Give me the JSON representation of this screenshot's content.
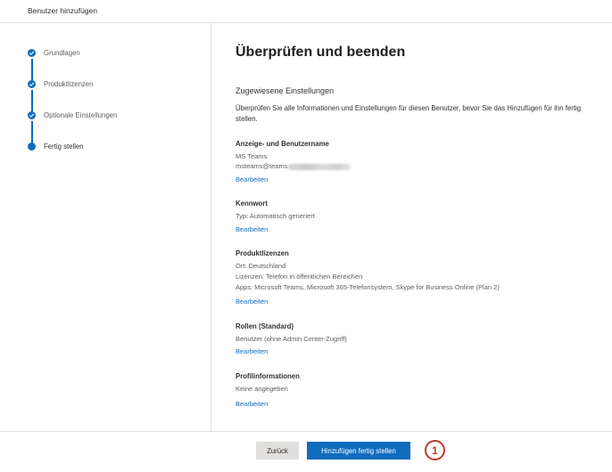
{
  "header": {
    "title": "Benutzer hinzufügen"
  },
  "steps": [
    {
      "label": "Grundlagen",
      "state": "done"
    },
    {
      "label": "Produktlizenzen",
      "state": "done"
    },
    {
      "label": "Optionale Einstellungen",
      "state": "done"
    },
    {
      "label": "Fertig stellen",
      "state": "current"
    }
  ],
  "main": {
    "title": "Überprüfen und beenden",
    "subtitle": "Zugewiesene Einstellungen",
    "intro": "Überprüfen Sie alle Informationen und Einstellungen für diesen Benutzer, bevor Sie das Hinzufügen für ihn fertig stellen.",
    "edit_label": "Bearbeiten",
    "sections": {
      "display": {
        "title": "Anzeige- und Benutzername",
        "line1": "MS Teams",
        "line2": "msteams@teams"
      },
      "password": {
        "title": "Kennwort",
        "line1": "Typ: Automatisch generiert"
      },
      "licenses": {
        "title": "Produktlizenzen",
        "line1": "Ort: Deutschland",
        "line2": "Lizenzen: Telefon in öffentlichen Bereichen",
        "line3": "Apps: Microsoft Teams, Microsoft 365-Telefonsystem, Skype for Business Online (Plan 2)"
      },
      "roles": {
        "title": "Rollen (Standard)",
        "line1": "Benutzer (ohne Admin Center-Zugriff)"
      },
      "profile": {
        "title": "Profilinformationen",
        "line1": "Keine angegeben"
      }
    }
  },
  "footer": {
    "back_label": "Zurück",
    "finish_label": "Hinzufügen fertig stellen",
    "callout_number": "1"
  },
  "colors": {
    "accent": "#0f6cbd",
    "callout": "#c0392b",
    "divider": "#e1dfdd"
  },
  "icons": {
    "done_step": "checkmark-circle-icon",
    "current_step": "filled-circle-icon"
  }
}
